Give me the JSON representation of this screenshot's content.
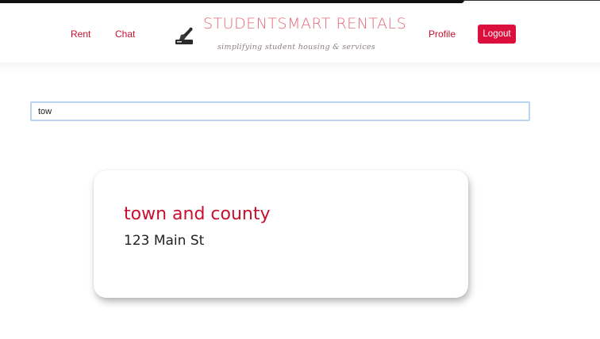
{
  "nav": {
    "rent_label": "Rent",
    "chat_label": "Chat",
    "profile_label": "Profile",
    "logout_label": "Logout"
  },
  "brand": {
    "title": "STUDENTSMART RENTALS",
    "tagline": "simplifying student housing & services",
    "logo_icon": "stamp-icon"
  },
  "search": {
    "value": "tow"
  },
  "results": [
    {
      "name": "town and county",
      "address": "123 Main St"
    }
  ],
  "colors": {
    "accent": "#c8102e",
    "logout_bg": "#dc0f3c",
    "brand_title": "#e66a7a",
    "search_border": "#b9d3f1"
  }
}
